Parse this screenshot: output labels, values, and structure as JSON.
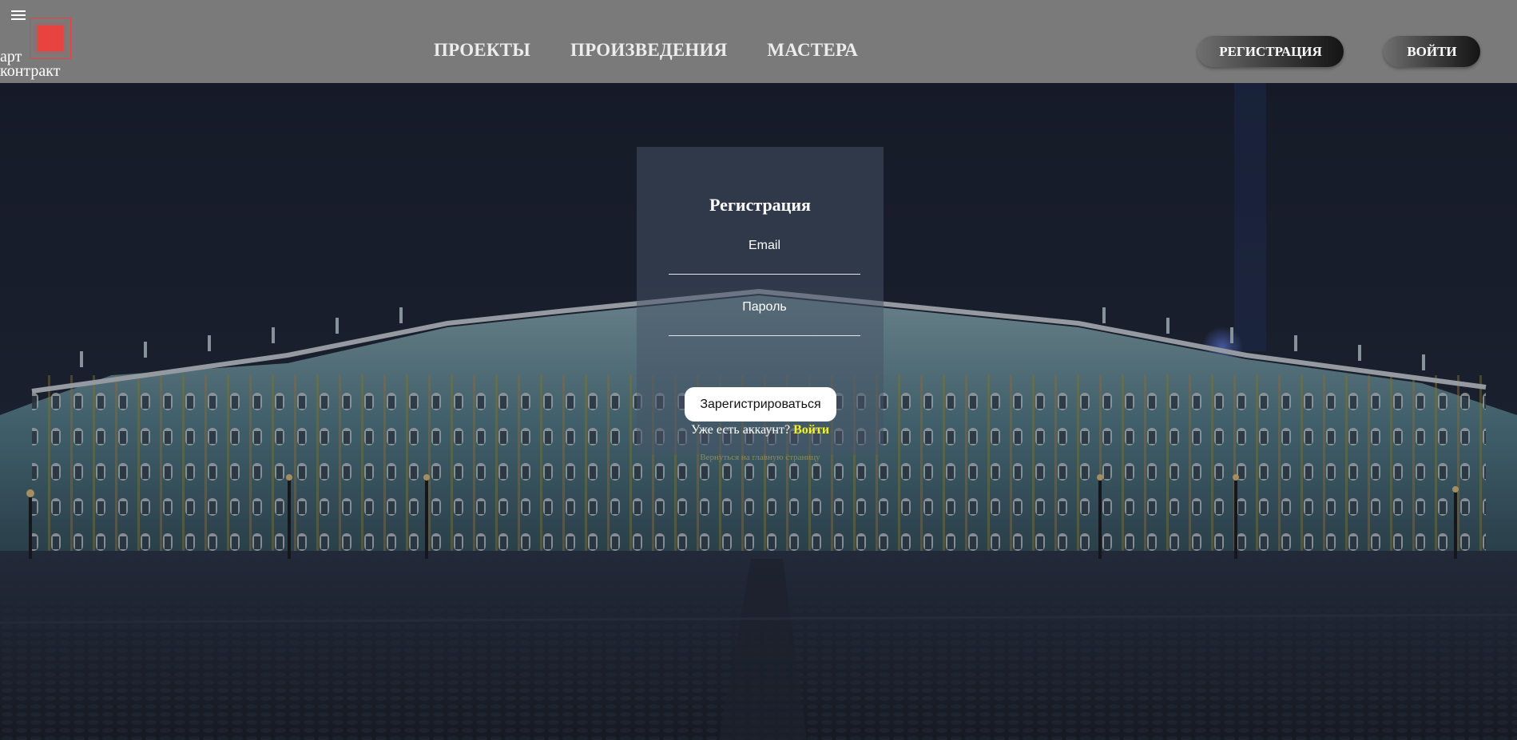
{
  "brand": {
    "line1": "арт",
    "line2": "контракт",
    "accent_color": "#e8433f"
  },
  "nav": {
    "items": [
      {
        "label": "ПРОЕКТЫ"
      },
      {
        "label": "ПРОИЗВЕДЕНИЯ"
      },
      {
        "label": "МАСТЕРА"
      }
    ]
  },
  "header_actions": {
    "register_label": "РЕГИСТРАЦИЯ",
    "login_label": "ВОЙТИ"
  },
  "form": {
    "title": "Регистрация",
    "email_placeholder": "Email",
    "password_placeholder": "Пароль",
    "submit_label": "Зарегистрироваться",
    "have_account_text": "Уже есть аккаунт? ",
    "login_link": "Войти",
    "back_link": "Вернуться на главную страницу",
    "link_color": "#f4f31f"
  },
  "icons": {
    "menu": "hamburger-menu-icon",
    "logo": "logo-square-icon"
  }
}
